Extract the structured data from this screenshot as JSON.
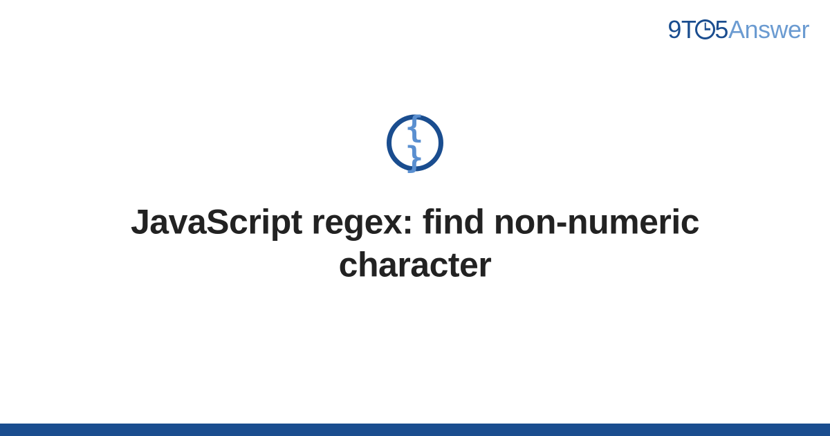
{
  "logo": {
    "part1": "9T",
    "part2": "5",
    "part3": "Answer"
  },
  "icon": {
    "braces": "{ }"
  },
  "title": "JavaScript regex: find non-numeric character"
}
